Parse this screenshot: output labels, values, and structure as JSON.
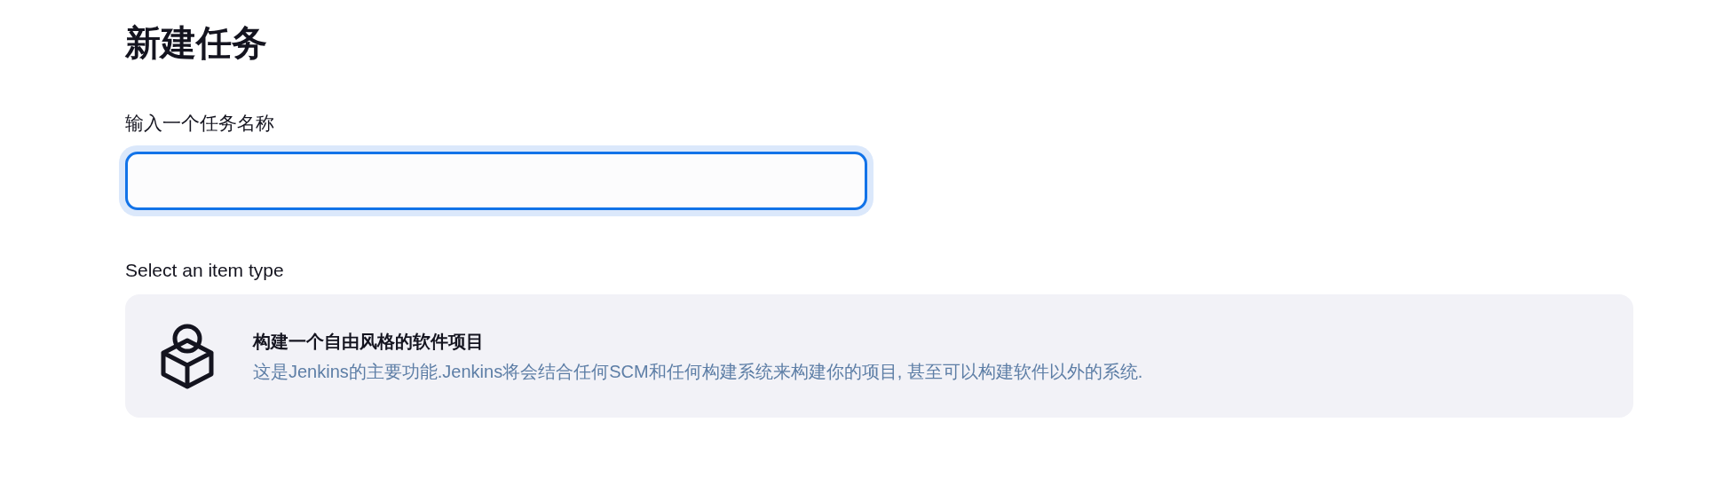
{
  "page_title": "新建任务",
  "name_field": {
    "label": "输入一个任务名称",
    "focused": true
  },
  "item_types": {
    "heading": "Select an item type",
    "items": [
      {
        "title": "构建一个自由风格的软件项目",
        "description": "这是Jenkins的主要功能.Jenkins将会结合任何SCM和任何构建系统来构建你的项目, 甚至可以构建软件以外的系统."
      }
    ]
  }
}
